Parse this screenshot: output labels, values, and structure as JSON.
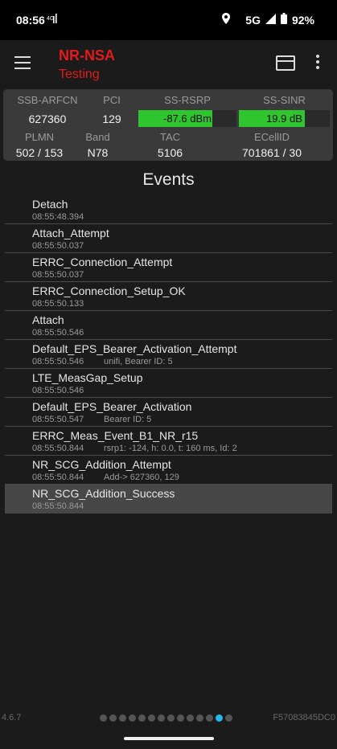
{
  "status_bar": {
    "time": "08:56",
    "network_small": "4G",
    "network": "5G",
    "battery": "92%"
  },
  "app": {
    "title": "NR-NSA",
    "subtitle": "Testing"
  },
  "metrics": {
    "row1_labels": [
      "SSB-ARFCN",
      "PCI",
      "SS-RSRP",
      "SS-SINR"
    ],
    "ssb_arfcn": "627360",
    "pci": "129",
    "ss_rsrp": "-87.6 dBm",
    "ss_rsrp_level": 0.75,
    "ss_sinr": "19.9 dB",
    "ss_sinr_level": 0.73,
    "row2_labels": [
      "PLMN",
      "Band",
      "TAC",
      "ECellID"
    ],
    "plmn": "502 / 153",
    "band": "N78",
    "tac": "5106",
    "ecellid": "701861 / 30",
    "bar_color": "#2ec52e"
  },
  "events_title": "Events",
  "events": [
    {
      "name": "Detach",
      "time": "08:55:48.394",
      "detail": ""
    },
    {
      "name": "Attach_Attempt",
      "time": "08:55:50.037",
      "detail": ""
    },
    {
      "name": "ERRC_Connection_Attempt",
      "time": "08:55:50.037",
      "detail": ""
    },
    {
      "name": "ERRC_Connection_Setup_OK",
      "time": "08:55:50.133",
      "detail": ""
    },
    {
      "name": "Attach",
      "time": "08:55:50.546",
      "detail": ""
    },
    {
      "name": "Default_EPS_Bearer_Activation_Attempt",
      "time": "08:55:50.546",
      "detail": "unifi, Bearer ID: 5"
    },
    {
      "name": "LTE_MeasGap_Setup",
      "time": "08:55:50.546",
      "detail": ""
    },
    {
      "name": "Default_EPS_Bearer_Activation",
      "time": "08:55:50.547",
      "detail": "Bearer ID: 5"
    },
    {
      "name": "ERRC_Meas_Event_B1_NR_r15",
      "time": "08:55:50.844",
      "detail": "rsrp1: -124, h: 0.0, t: 160 ms, Id: 2"
    },
    {
      "name": "NR_SCG_Addition_Attempt",
      "time": "08:55:50.844",
      "detail": "Add-> 627360, 129"
    },
    {
      "name": "NR_SCG_Addition_Success",
      "time": "08:55:50.844",
      "detail": ""
    }
  ],
  "selected_event": 10,
  "footer": {
    "version": "4.6.7",
    "device_id": "F57083845DC0",
    "page_count": 14,
    "active_page": 12,
    "accent": "#27b7e8"
  }
}
